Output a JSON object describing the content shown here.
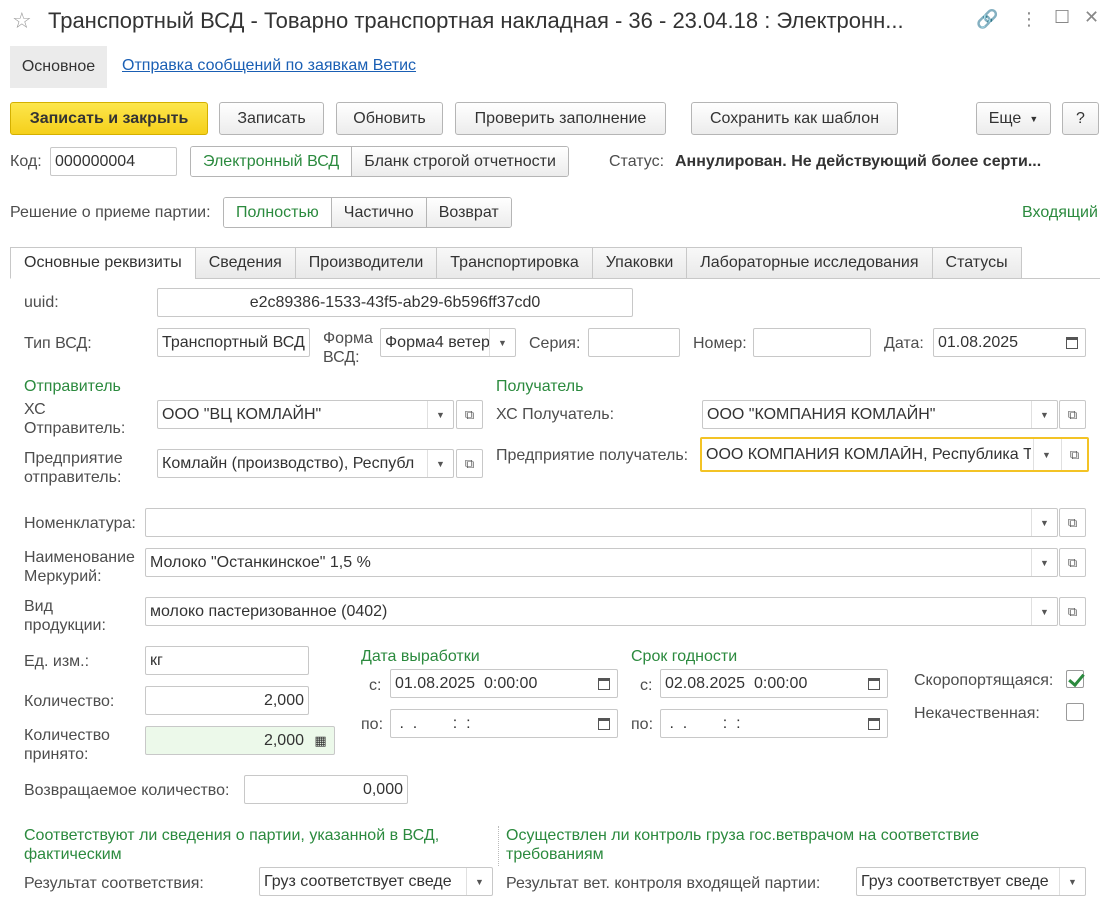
{
  "window": {
    "title": "Транспортный ВСД  - Товарно транспортная накладная - 36 - 23.04.18 : Электронн..."
  },
  "nav": {
    "main_tab": "Основное",
    "link": "Отправка сообщений по заявкам Ветис"
  },
  "toolbar": {
    "save_close": "Записать и закрыть",
    "save": "Записать",
    "refresh": "Обновить",
    "check": "Проверить заполнение",
    "save_template": "Сохранить как шаблон",
    "more": "Еще",
    "help": "?"
  },
  "header": {
    "code_label": "Код:",
    "code_value": "000000004",
    "type_options": [
      "Электронный ВСД",
      "Бланк строгой отчетности"
    ],
    "status_label": "Статус:",
    "status_value": "Аннулирован. Не действующий более серти...",
    "decision_label": "Решение о приеме партии:",
    "decision_options": [
      "Полностью",
      "Частично",
      "Возврат"
    ],
    "direction": "Входящий"
  },
  "tabs": [
    "Основные реквизиты",
    "Сведения",
    "Производители",
    "Транспортировка",
    "Упаковки",
    "Лабораторные исследования",
    "Статусы"
  ],
  "form": {
    "uuid_label": "uuid:",
    "uuid_value": "e2c89386-1533-43f5-ab29-6b596ff37cd0",
    "vsd_type_label": "Тип ВСД:",
    "vsd_type_value": "Транспортный ВСД",
    "vsd_form_label_1": "Форма",
    "vsd_form_label_2": "ВСД:",
    "vsd_form_value": "Форма4 ветер",
    "series_label": "Серия:",
    "series_value": "",
    "number_label": "Номер:",
    "number_value": "",
    "date_label": "Дата:",
    "date_value": "01.08.2025",
    "sender_header": "Отправитель",
    "sender_hs_label_1": "ХС",
    "sender_hs_label_2": "Отправитель:",
    "sender_hs_value": "ООО \"ВЦ КОМЛАЙН\"",
    "sender_ent_label_1": "Предприятие",
    "sender_ent_label_2": "отправитель:",
    "sender_ent_value": "Комлайн (производство), Республ",
    "recipient_header": "Получатель",
    "recipient_hs_label": "ХС Получатель:",
    "recipient_hs_value": "ООО \"КОМПАНИЯ КОМЛАЙН\"",
    "recipient_ent_label": "Предприятие получатель:",
    "recipient_ent_value": "ООО КОМПАНИЯ КОМЛАЙН, Республика Т",
    "nomenclature_label": "Номенклатура:",
    "nomenclature_value": "",
    "mercury_name_label_1": "Наименование",
    "mercury_name_label_2": "Меркурий:",
    "mercury_name_value": "Молоко \"Останкинское\" 1,5 %",
    "product_kind_label_1": "Вид",
    "product_kind_label_2": "продукции:",
    "product_kind_value": "молоко пастеризованное (0402)",
    "unit_label": "Ед. изм.:",
    "unit_value": "кг",
    "qty_label": "Количество:",
    "qty_value": "2,000",
    "qty_accepted_label_1": "Количество",
    "qty_accepted_label_2": "принято:",
    "qty_accepted_value": "2,000",
    "returned_label": "Возвращаемое количество:",
    "returned_value": "0,000",
    "prod_date_header": "Дата выработки",
    "prod_from_label": "с:",
    "prod_from_value": "01.08.2025  0:00:00",
    "prod_to_label": "по:",
    "prod_to_value": " .  .        :  :",
    "expiry_header": "Срок годности",
    "exp_from_label": "с:",
    "exp_from_value": "02.08.2025  0:00:00",
    "exp_to_label": "по:",
    "exp_to_value": " .  .        :  :",
    "perishable_label": "Скоропортящаяся:",
    "perishable": true,
    "poor_quality_label": "Некачественная:",
    "poor_quality": false,
    "conformity_header_1": "Соответствуют ли сведения о партии, указанной в ВСД,",
    "conformity_header_2": "фактическим",
    "conformity_result_label": "Результат соответствия:",
    "conformity_result_value": "Груз соответствует сведе",
    "vet_control_header_1": "Осуществлен ли контроль груза гос.ветврачом на соответствие",
    "vet_control_header_2": "требованиям",
    "vet_result_label": "Результат вет. контроля входящей партии:",
    "vet_result_value": "Груз соответствует сведе"
  },
  "colors": {
    "accent_green": "#2b8a3e",
    "primary_button": "#f5d01b",
    "focus_border": "#f3c325",
    "link": "#1a5fb4"
  }
}
